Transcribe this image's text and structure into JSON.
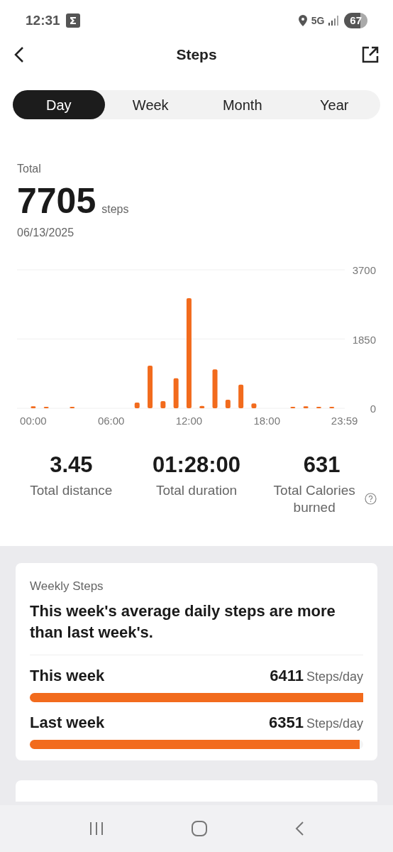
{
  "status_bar": {
    "time": "12:31",
    "network": "5G",
    "battery": "67"
  },
  "header": {
    "title": "Steps"
  },
  "tabs": [
    {
      "label": "Day",
      "selected": true
    },
    {
      "label": "Week",
      "selected": false
    },
    {
      "label": "Month",
      "selected": false
    },
    {
      "label": "Year",
      "selected": false
    }
  ],
  "summary": {
    "label": "Total",
    "value": "7705",
    "unit": "steps",
    "date": "06/13/2025"
  },
  "chart_data": {
    "type": "bar",
    "x": [
      0,
      1,
      3,
      8,
      9,
      10,
      11,
      12,
      13,
      14,
      15,
      16,
      17,
      20,
      21,
      22,
      23
    ],
    "values": [
      50,
      20,
      20,
      150,
      1140,
      190,
      800,
      2940,
      60,
      1040,
      230,
      630,
      130,
      20,
      50,
      20,
      30
    ],
    "xlim": [
      -1.25,
      24
    ],
    "ylim": [
      0,
      3700
    ],
    "yticks": [
      0,
      1850,
      3700
    ],
    "xticks": [
      {
        "value": 0,
        "label": "00:00"
      },
      {
        "value": 6,
        "label": "06:00"
      },
      {
        "value": 12,
        "label": "12:00"
      },
      {
        "value": 18,
        "label": "18:00"
      },
      {
        "value": 23.98,
        "label": "23:59"
      }
    ]
  },
  "stats": [
    {
      "value": "3.45",
      "label": "Total distance",
      "help": false
    },
    {
      "value": "01:28:00",
      "label": "Total duration",
      "help": false
    },
    {
      "value": "631",
      "label": "Total Calories burned",
      "help": true
    }
  ],
  "weekly_card": {
    "title": "Weekly Steps",
    "message": "This week's average daily steps are more than last week's.",
    "rows": [
      {
        "label": "This week",
        "value": "6411",
        "unit": "Steps/day",
        "level": 1.0
      },
      {
        "label": "Last week",
        "value": "6351",
        "unit": "Steps/day",
        "level": 0.99
      }
    ]
  }
}
